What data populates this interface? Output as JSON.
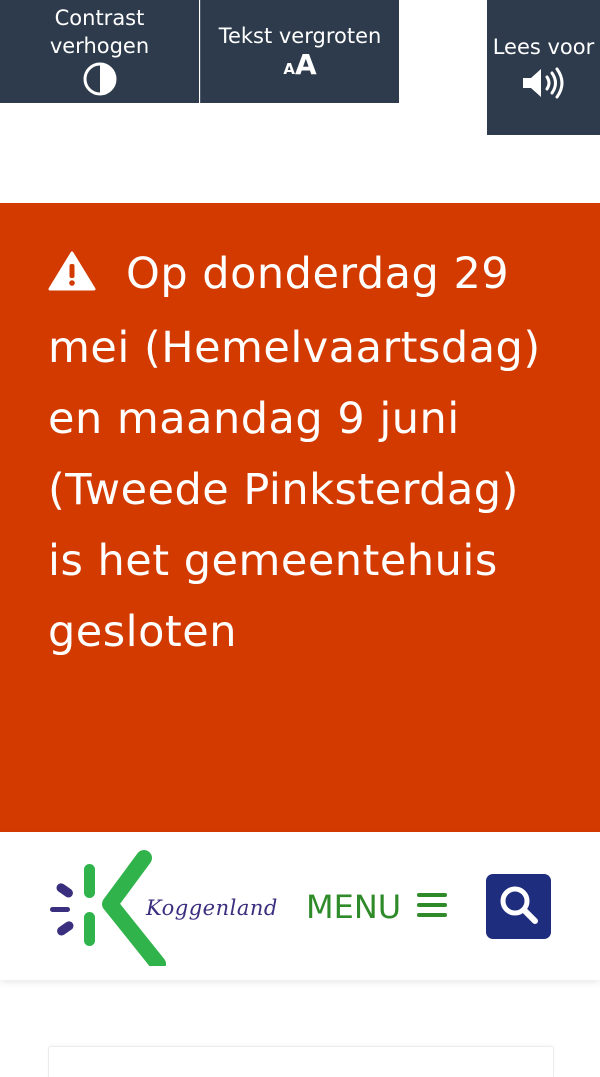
{
  "toolbar": {
    "contrast_label": "Contrast\nverhogen",
    "contrast_icon": "half-circle-icon",
    "text_size_label": "Tekst vergroten",
    "text_size_icon_small": "A",
    "text_size_icon_big": "A",
    "read_aloud_label": "Lees voor",
    "read_aloud_icon": "speaker-icon"
  },
  "alert": {
    "icon": "warning-triangle-icon",
    "message": "Op donderdag 29 mei (Hemelvaartsdag) en maandag 9 juni (Tweede Pinksterdag) is het gemeentehuis gesloten"
  },
  "header": {
    "logo_text": "Koggenland",
    "menu_label": "MENU",
    "menu_icon": "hamburger-icon",
    "search_icon": "search-icon"
  },
  "colors": {
    "toolbar_bg": "#2d3b4c",
    "alert_bg": "#d33a00",
    "brand_green": "#2f8a2a",
    "brand_purple": "#3a2e7e",
    "search_bg": "#1e2d7d"
  }
}
